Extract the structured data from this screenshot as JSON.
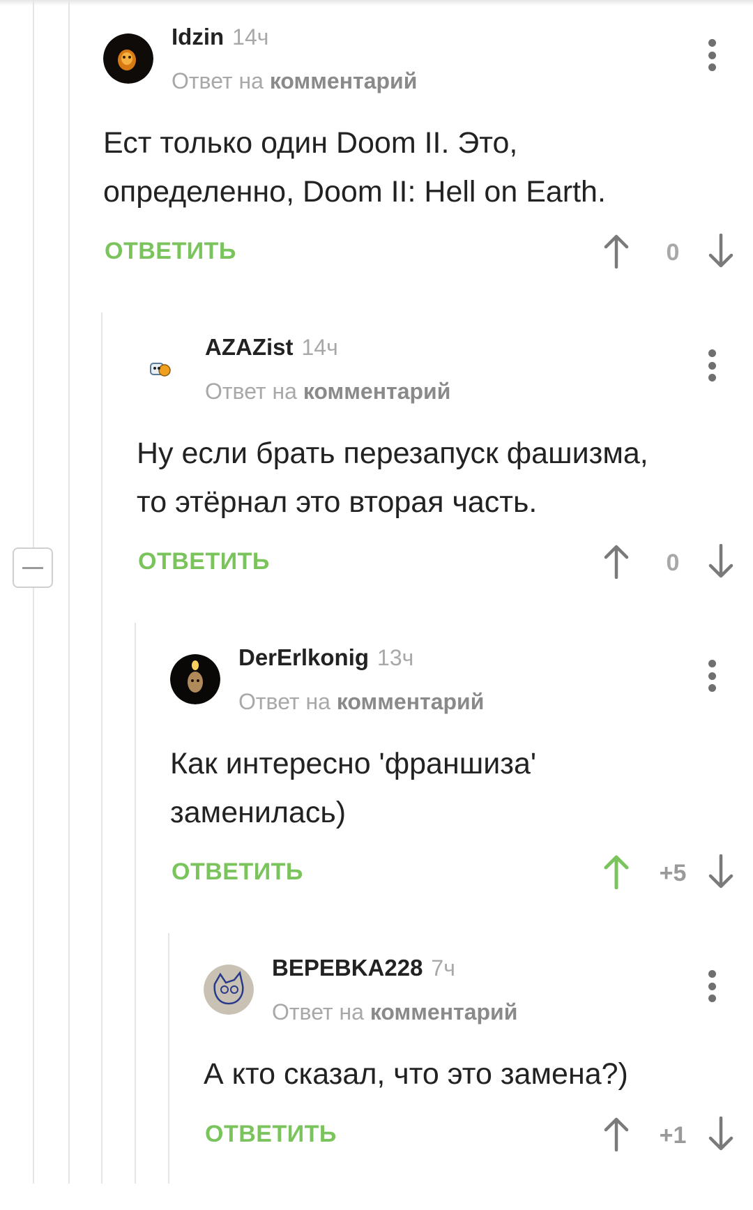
{
  "ui": {
    "reply_label": "ОТВЕТИТЬ",
    "reply_to_prefix": "Ответ на",
    "reply_to_link": "комментарий"
  },
  "colors": {
    "accent_green": "#7bc45d",
    "muted_gray": "#a8a8a8",
    "text": "#222222",
    "thread_line": "#e5e5e5"
  },
  "comments": [
    {
      "username": "Idzin",
      "time": "14ч",
      "text_lines": [
        "Ест только один Doom II. Это,",
        "определенно, Doom II: Hell on Earth."
      ],
      "score": "0",
      "voted": "none"
    },
    {
      "username": "AZAZist",
      "time": "14ч",
      "text_lines": [
        "Ну если брать перезапуск фашизма,",
        "то этёрнал это вторая часть."
      ],
      "score": "0",
      "voted": "none"
    },
    {
      "username": "DerErlkonig",
      "time": "13ч",
      "text_lines": [
        "Как интересно 'франшиза'",
        "заменилась)"
      ],
      "score": "+5",
      "voted": "up"
    },
    {
      "username": "BEPEBKA228",
      "time": "7ч",
      "text_lines": [
        "А кто сказал, что это замена?)"
      ],
      "score": "+1",
      "voted": "none"
    }
  ]
}
